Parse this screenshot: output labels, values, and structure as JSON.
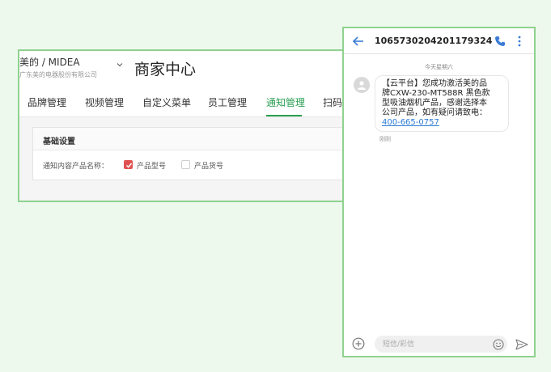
{
  "admin": {
    "brand": "美的 / MIDEA",
    "company": "广东美的电器股份有限公司",
    "title": "商家中心",
    "nav": [
      {
        "label": "品牌管理",
        "active": false
      },
      {
        "label": "视频管理",
        "active": false
      },
      {
        "label": "自定义菜单",
        "active": false
      },
      {
        "label": "员工管理",
        "active": false
      },
      {
        "label": "通知管理",
        "active": true
      },
      {
        "label": "扫码激",
        "active": false
      }
    ],
    "card_title": "基础设置",
    "field_label": "通知内容产品名称：",
    "options": [
      {
        "label": "产品型号",
        "checked": true
      },
      {
        "label": "产品货号",
        "checked": false
      }
    ],
    "accent": "#2a9f52"
  },
  "phone": {
    "number": "1065730204201179324",
    "date": "今天星期六",
    "message_lines": [
      "【云平台】您成功激活美的品",
      "牌CXW-230-MT588R 黑色款",
      "型吸油烟机产品，感谢选择本",
      "公司产品，如有疑问请致电："
    ],
    "phone_link": "400-665-0757",
    "time": "刚刚",
    "input_placeholder": "短信/彩信",
    "link_color": "#2b7bd6"
  }
}
